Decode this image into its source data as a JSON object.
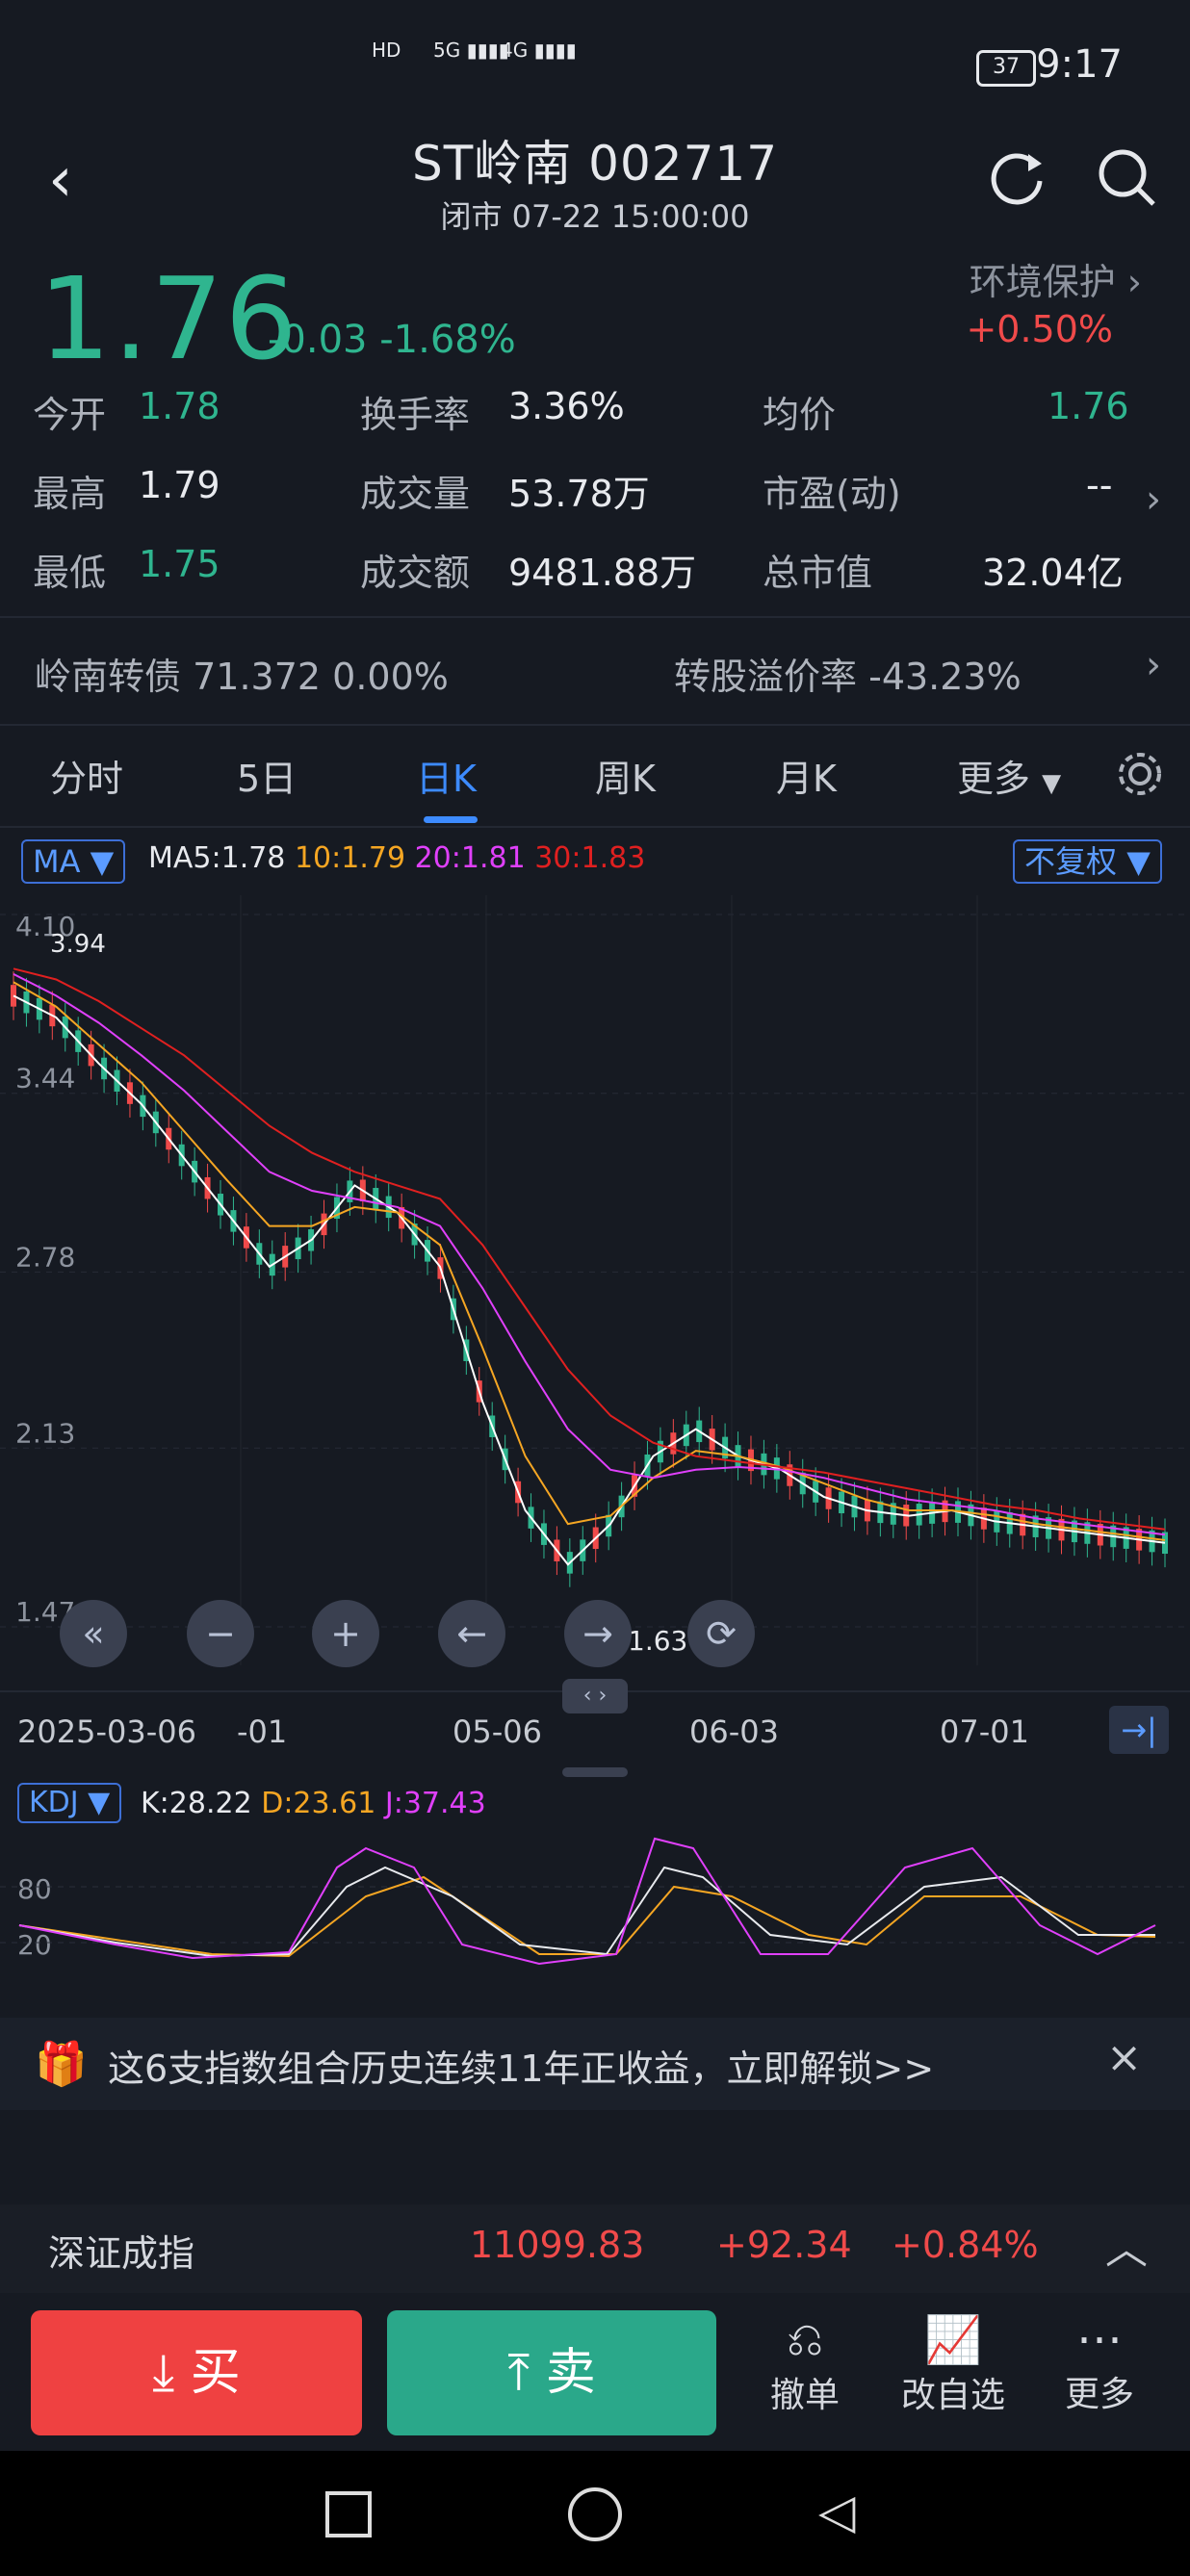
{
  "status_bar": {
    "time": "9:17",
    "battery": "37",
    "signal_labels": [
      "HD",
      "5G",
      "4G"
    ]
  },
  "header": {
    "title": "ST岭南 002717",
    "subtitle": "闭市 07-22 15:00:00"
  },
  "quote": {
    "price": "1.76",
    "change": "-0.03",
    "change_pct": "-1.68%",
    "sector": "环境保护",
    "sector_change": "+0.50%"
  },
  "stats": [
    {
      "label": "今开",
      "value": "1.78",
      "color": "green"
    },
    {
      "label": "换手率",
      "value": "3.36%",
      "color": "white"
    },
    {
      "label": "均价",
      "value": "1.76",
      "color": "green"
    },
    {
      "label": "最高",
      "value": "1.79",
      "color": "white"
    },
    {
      "label": "成交量",
      "value": "53.78万",
      "color": "white"
    },
    {
      "label": "市盈(动)",
      "value": "--",
      "color": "white"
    },
    {
      "label": "最低",
      "value": "1.75",
      "color": "green"
    },
    {
      "label": "成交额",
      "value": "9481.88万",
      "color": "white"
    },
    {
      "label": "总市值",
      "value": "32.04亿",
      "color": "white"
    }
  ],
  "bond": {
    "name": "岭南转债",
    "price": "71.372",
    "pct": "0.00%",
    "premium_label": "转股溢价率",
    "premium": "-43.23%"
  },
  "tabs": [
    "分时",
    "5日",
    "日K",
    "周K",
    "月K",
    "更多"
  ],
  "active_tab": "日K",
  "ma_bar": {
    "indicator": "MA",
    "ma5": "MA5:1.78",
    "ma10": "10:1.79",
    "ma20": "20:1.81",
    "ma30": "30:1.83",
    "adjust": "不复权"
  },
  "chart_data": {
    "type": "line",
    "title": "",
    "y_ticks": [
      "4.10",
      "3.44",
      "2.78",
      "2.13",
      "1.47"
    ],
    "x_ticks": [
      "2025-03-06",
      "-01",
      "05-06",
      "06-03",
      "07-01"
    ],
    "ylim": [
      1.47,
      4.1
    ],
    "annotations": [
      {
        "text": "3.94"
      },
      {
        "text": "1.63"
      }
    ],
    "series": [
      {
        "name": "MA5",
        "color": "#ffffff",
        "values": [
          3.8,
          3.72,
          3.55,
          3.4,
          3.2,
          3.0,
          2.8,
          2.9,
          3.1,
          3.0,
          2.8,
          2.3,
          1.9,
          1.7,
          1.85,
          2.1,
          2.2,
          2.1,
          2.05,
          1.95,
          1.9,
          1.88,
          1.9,
          1.86,
          1.84,
          1.82,
          1.8,
          1.78
        ]
      },
      {
        "name": "10",
        "color": "#f5a623",
        "values": [
          3.85,
          3.76,
          3.62,
          3.48,
          3.3,
          3.12,
          2.95,
          2.95,
          3.02,
          3.0,
          2.88,
          2.5,
          2.1,
          1.85,
          1.88,
          2.02,
          2.12,
          2.1,
          2.06,
          2.0,
          1.94,
          1.9,
          1.9,
          1.88,
          1.85,
          1.83,
          1.81,
          1.79
        ]
      },
      {
        "name": "20",
        "color": "#e040fb",
        "values": [
          3.88,
          3.8,
          3.7,
          3.58,
          3.45,
          3.3,
          3.15,
          3.08,
          3.05,
          3.02,
          2.95,
          2.72,
          2.45,
          2.2,
          2.05,
          2.02,
          2.05,
          2.06,
          2.05,
          2.02,
          1.98,
          1.94,
          1.92,
          1.9,
          1.87,
          1.85,
          1.83,
          1.81
        ]
      },
      {
        "name": "30",
        "color": "#e02020",
        "values": [
          3.9,
          3.86,
          3.78,
          3.68,
          3.58,
          3.45,
          3.32,
          3.22,
          3.15,
          3.1,
          3.05,
          2.88,
          2.65,
          2.42,
          2.25,
          2.15,
          2.1,
          2.08,
          2.06,
          2.04,
          2.01,
          1.98,
          1.95,
          1.92,
          1.9,
          1.87,
          1.85,
          1.83
        ]
      }
    ]
  },
  "kdj": {
    "indicator": "KDJ",
    "k": "K:28.22",
    "d": "D:23.61",
    "j": "J:37.43",
    "y_ticks": [
      "80",
      "20"
    ]
  },
  "promo": {
    "text": "这6支指数组合历史连续11年正收益，立即解锁>>"
  },
  "index": {
    "name": "深证成指",
    "value": "11099.83",
    "change": "+92.34",
    "pct": "+0.84%"
  },
  "actions": {
    "buy": "买",
    "sell": "卖",
    "cancel": "撤单",
    "edit_watch": "改自选",
    "more": "更多"
  }
}
